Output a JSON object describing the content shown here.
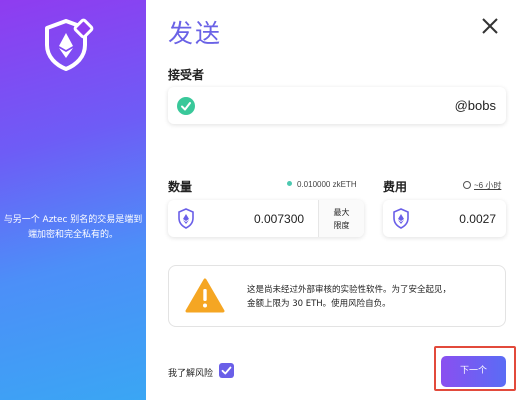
{
  "sidebar": {
    "description": "与另一个 Aztec 别名的交易是端到端加密和完全私有的。",
    "logo_icon": "eth-shield-icon",
    "colors": {
      "gradient_top": "#8f3cf0",
      "gradient_bottom": "#3aa6f4"
    }
  },
  "header": {
    "title": "发送",
    "close_icon": "close-icon"
  },
  "recipient": {
    "label": "接受者",
    "value": "@bobs",
    "status_icon": "check-circle-icon",
    "status_color": "#39c89a"
  },
  "amount": {
    "label": "数量",
    "balance": "0.010000 zkETH",
    "value": "0.007300",
    "max_label_1": "最大",
    "max_label_2": "限度",
    "token_icon": "eth-shield-icon"
  },
  "fee": {
    "label": "费用",
    "time_estimate": "~6 小时",
    "value": "0.0027",
    "token_icon": "eth-shield-icon"
  },
  "warning": {
    "icon": "warning-triangle-icon",
    "text_line1": "这是尚未经过外部审核的实验性软件。为了安全起见，",
    "text_line2": "金额上限为 30 ETH。使用风险自负。",
    "icon_color": "#f5a623"
  },
  "footer": {
    "ack_label": "我了解风险",
    "ack_checked": true,
    "next_label": "下一个",
    "accent": "#6a5fe8"
  }
}
